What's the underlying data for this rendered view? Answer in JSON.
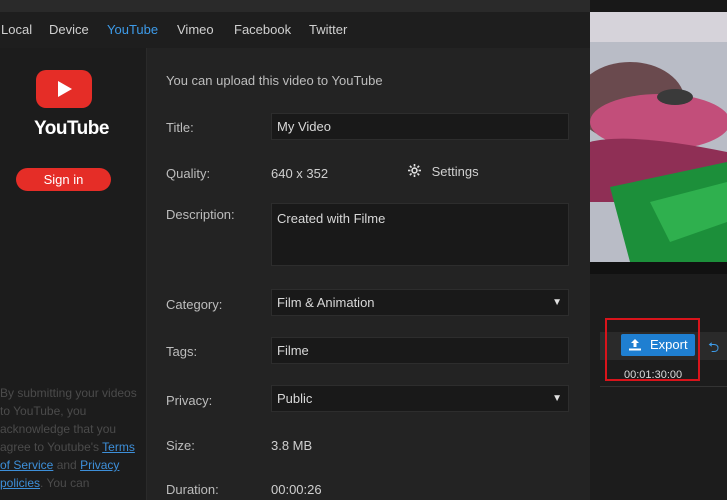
{
  "tabs": [
    "Local",
    "Device",
    "YouTube",
    "Vimeo",
    "Facebook",
    "Twitter"
  ],
  "active_tab": "YouTube",
  "left": {
    "logo_word": "YouTube",
    "signin_label": "Sign in",
    "disclaimer_prefix": "By submitting your videos to YouTube, you acknowledge that you agree to Youtube's",
    "terms_link": "Terms of Service",
    "and_text": "and",
    "privacy_link": "Privacy policies",
    "disclaimer_suffix": ". You can"
  },
  "form": {
    "intro": "You can upload this video to YouTube",
    "title_label": "Title:",
    "title_value": "My Video",
    "quality_label": "Quality:",
    "quality_value": "640 x 352",
    "settings_label": "Settings",
    "description_label": "Description:",
    "description_value": "Created with Filme",
    "category_label": "Category:",
    "category_value": "Film & Animation",
    "tags_label": "Tags:",
    "tags_value": "Filme",
    "privacy_label": "Privacy:",
    "privacy_value": "Public",
    "size_label": "Size:",
    "size_value": "3.8 MB",
    "duration_label": "Duration:",
    "duration_value": "00:00:26"
  },
  "right": {
    "export_label": "Export",
    "timecode": "00:01:30:00"
  },
  "colors": {
    "accent": "#3d9be9",
    "youtube_red": "#e52d27",
    "export_blue": "#1f7fd1",
    "highlight_red": "#d8141b"
  },
  "icons": {
    "settings": "gear-icon",
    "export": "upload-icon",
    "dropdown": "caret-down-icon",
    "undo": "undo-icon"
  }
}
